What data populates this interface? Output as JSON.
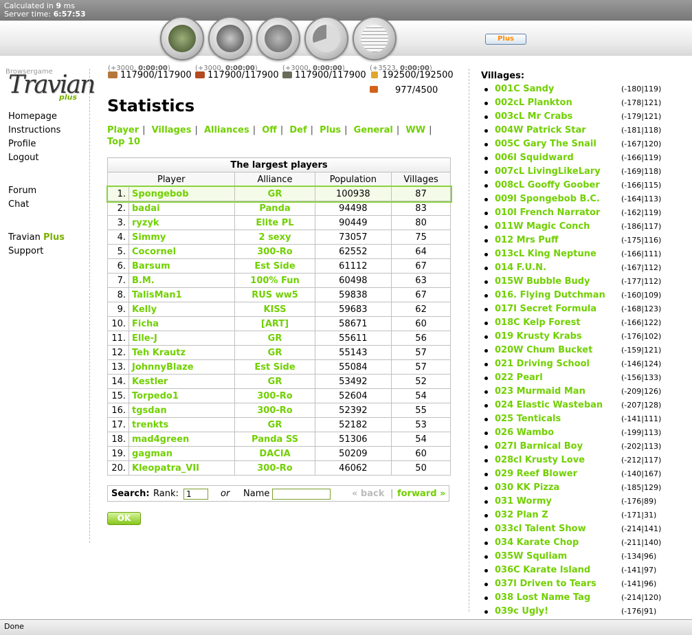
{
  "topbar": {
    "calc_prefix": "Calculated in",
    "calc_value": "9",
    "calc_unit": "ms",
    "server_time_label": "Server time:",
    "server_time": "6:57:53"
  },
  "nav_icons": [
    "village-overview-icon",
    "village-center-icon",
    "map-icon",
    "statistics-icon",
    "reports-icon"
  ],
  "plus_button": "Plus",
  "logo": {
    "small": "Browsergame",
    "main": "Travian",
    "sub": "plus"
  },
  "left_menu": {
    "group1": [
      "Homepage",
      "Instructions",
      "Profile",
      "Logout"
    ],
    "group2": [
      "Forum",
      "Chat"
    ],
    "travian": "Travian",
    "plus": "Plus",
    "support": "Support"
  },
  "resources": [
    {
      "prod": "(+3000, ",
      "prod_b": "0:00:00",
      "prod_end": ")",
      "value": "117900/117900",
      "color": "#b5763b"
    },
    {
      "prod": "(+3000, ",
      "prod_b": "0:00:00",
      "prod_end": ")",
      "value": "117900/117900",
      "color": "#b44a20"
    },
    {
      "prod": "(+3000, ",
      "prod_b": "0:00:00",
      "prod_end": ")",
      "value": "117900/117900",
      "color": "#6b6b5a"
    },
    {
      "prod": "(+3523, ",
      "prod_b": "0:00:00",
      "prod_end": ")",
      "value": "192500/192500",
      "color": "#e0a72c"
    }
  ],
  "crop_consumption": "977/4500",
  "page_title": "Statistics",
  "tabs": [
    "Player",
    "Villages",
    "Alliances",
    "Off",
    "Def",
    "Plus",
    "General",
    "WW",
    "Top 10"
  ],
  "table": {
    "caption": "The largest players",
    "headers": [
      "Player",
      "Alliance",
      "Population",
      "Villages"
    ],
    "rows": [
      [
        "1.",
        "Spongebob",
        "GR",
        "100938",
        "87"
      ],
      [
        "2.",
        "badai",
        "Panda",
        "94498",
        "83"
      ],
      [
        "3.",
        "ryzyk",
        "Elite PL",
        "90449",
        "80"
      ],
      [
        "4.",
        "Simmy",
        "2 sexy",
        "73057",
        "75"
      ],
      [
        "5.",
        "Cocornel",
        "300-Ro",
        "62552",
        "64"
      ],
      [
        "6.",
        "Barsum",
        "Est Side",
        "61112",
        "67"
      ],
      [
        "7.",
        "B.M.",
        "100% Fun",
        "60498",
        "63"
      ],
      [
        "8.",
        "TalisMan1",
        "RUS ww5",
        "59838",
        "67"
      ],
      [
        "9.",
        "Kelly",
        "KISS",
        "59683",
        "62"
      ],
      [
        "10.",
        "Ficha",
        "[ART]",
        "58671",
        "60"
      ],
      [
        "11.",
        "Elle-J",
        "GR",
        "55611",
        "56"
      ],
      [
        "12.",
        "Teh Krautz",
        "GR",
        "55143",
        "57"
      ],
      [
        "13.",
        "JohnnyBlaze",
        "Est Side",
        "55084",
        "57"
      ],
      [
        "14.",
        "Kestler",
        "GR",
        "53492",
        "52"
      ],
      [
        "15.",
        "Torpedo1",
        "300-Ro",
        "52604",
        "54"
      ],
      [
        "16.",
        "tgsdan",
        "300-Ro",
        "52392",
        "55"
      ],
      [
        "17.",
        "trenkts",
        "GR",
        "52182",
        "53"
      ],
      [
        "18.",
        "mad4green",
        "Panda SS",
        "51306",
        "54"
      ],
      [
        "19.",
        "gagman",
        "DACIA",
        "50209",
        "60"
      ],
      [
        "20.",
        "Kleopatra_VII",
        "300-Ro",
        "46062",
        "50"
      ]
    ]
  },
  "search": {
    "label": "Search:",
    "rank_label": "Rank:",
    "rank_value": "1",
    "or": "or",
    "name_label": "Name",
    "name_value": "",
    "back": "« back",
    "separator": "|",
    "forward": "forward »"
  },
  "ok_button": "OK",
  "villages_title": "Villages:",
  "villages": [
    [
      "001C Sandy",
      "(-180|119)"
    ],
    [
      "002cL Plankton",
      "(-178|121)"
    ],
    [
      "003cL Mr Crabs",
      "(-179|121)"
    ],
    [
      "004W Patrick Star",
      "(-181|118)"
    ],
    [
      "005C Gary The Snail",
      "(-167|120)"
    ],
    [
      "006I Squidward",
      "(-166|119)"
    ],
    [
      "007cL LivingLikeLary",
      "(-169|118)"
    ],
    [
      "008cL Gooffy Goober",
      "(-166|115)"
    ],
    [
      "009I Spongebob B.C.",
      "(-164|113)"
    ],
    [
      "010I French Narrator",
      "(-162|119)"
    ],
    [
      "011W Magic Conch",
      "(-186|117)"
    ],
    [
      "012 Mrs Puff",
      "(-175|116)"
    ],
    [
      "013cL King Neptune",
      "(-166|111)"
    ],
    [
      "014 F.U.N.",
      "(-167|112)"
    ],
    [
      "015W Bubble Budy",
      "(-177|112)"
    ],
    [
      "016. Flying Dutchman",
      "(-160|109)"
    ],
    [
      "017I Secret Formula",
      "(-168|123)"
    ],
    [
      "018C Kelp Forest",
      "(-166|122)"
    ],
    [
      "019 Krusty Krabs",
      "(-176|102)"
    ],
    [
      "020W Chum Bucket",
      "(-159|121)"
    ],
    [
      "021 Driving School",
      "(-146|124)"
    ],
    [
      "022 Pearl",
      "(-156|133)"
    ],
    [
      "023 Murmaid Man",
      "(-209|126)"
    ],
    [
      "024 Elastic Wasteban",
      "(-207|128)"
    ],
    [
      "025 Tenticals",
      "(-141|111)"
    ],
    [
      "026 Wambo",
      "(-199|113)"
    ],
    [
      "027I Barnical Boy",
      "(-202|113)"
    ],
    [
      "028cl Krusty Love",
      "(-212|117)"
    ],
    [
      "029 Reef Blower",
      "(-140|167)"
    ],
    [
      "030 KK Pizza",
      "(-185|129)"
    ],
    [
      "031 Wormy",
      "(-176|89)"
    ],
    [
      "032 Plan Z",
      "(-171|31)"
    ],
    [
      "033cl Talent Show",
      "(-214|141)"
    ],
    [
      "034 Karate Chop",
      "(-211|140)"
    ],
    [
      "035W Squliam",
      "(-134|96)"
    ],
    [
      "036C Karate Island",
      "(-141|97)"
    ],
    [
      "037I Driven to Tears",
      "(-141|96)"
    ],
    [
      "038 Lost Name Tag",
      "(-214|120)"
    ],
    [
      "039c Ugly!",
      "(-176|91)"
    ]
  ],
  "statusbar": "Done"
}
